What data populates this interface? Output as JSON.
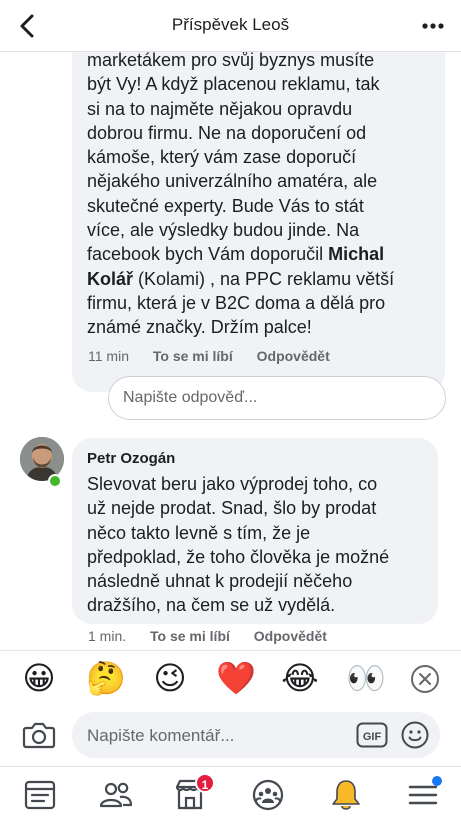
{
  "header": {
    "title": "Příspěvek Leoš"
  },
  "comment1": {
    "text_lines": [
      "marketákem pro svůj byznys musíte",
      "být Vy! A když placenou reklamu, tak",
      "si na to najměte nějakou opravdu",
      "dobrou firmu. Ne na doporučení od",
      "kámoše, který vám zase doporučí",
      "nějakého univerzálního amatéra, ale",
      "skutečné experty. Bude Vás to stát",
      "více, ale výsledky budou jinde. Na"
    ],
    "line9_pre": "facebook bych Vám doporučil ",
    "line9_bold": "Michal",
    "line10_bold": "Kolář",
    "line10_post": " (Kolami) , na PPC reklamu větší",
    "line11": "firmu, která je v B2C doma a dělá pro",
    "line12": "známé značky. Držím palce!",
    "time": "11 min",
    "like_label": "To se mi líbí",
    "reply_label": "Odpovědět"
  },
  "reply_input": {
    "placeholder": "Napište odpověď..."
  },
  "comment2": {
    "author": "Petr Ozogán",
    "text_lines": [
      "Slevovat beru jako výprodej toho, co",
      "už nejde prodat. Snad, šlo by prodat",
      "něco takto levně s tím, že je",
      "předpoklad, že toho člověka je možné",
      "následně uhnat k prodejií něčeho",
      "dražšího, na čem se už vydělá."
    ],
    "time": "1 min.",
    "like_label": "To se mi líbí",
    "reply_label": "Odpovědět",
    "online": true
  },
  "emoji_bar": {
    "emojis": [
      "😀",
      "🤔",
      "😉",
      "❤️",
      "😂",
      "👀"
    ]
  },
  "composer": {
    "placeholder": "Napište komentář...",
    "gif_label": "GIF"
  },
  "tabbar": {
    "marketplace_badge": "1"
  },
  "colors": {
    "bubble": "#f0f2f5",
    "online": "#42b72a",
    "badge": "#e41e3f",
    "accent": "#1877f2"
  }
}
